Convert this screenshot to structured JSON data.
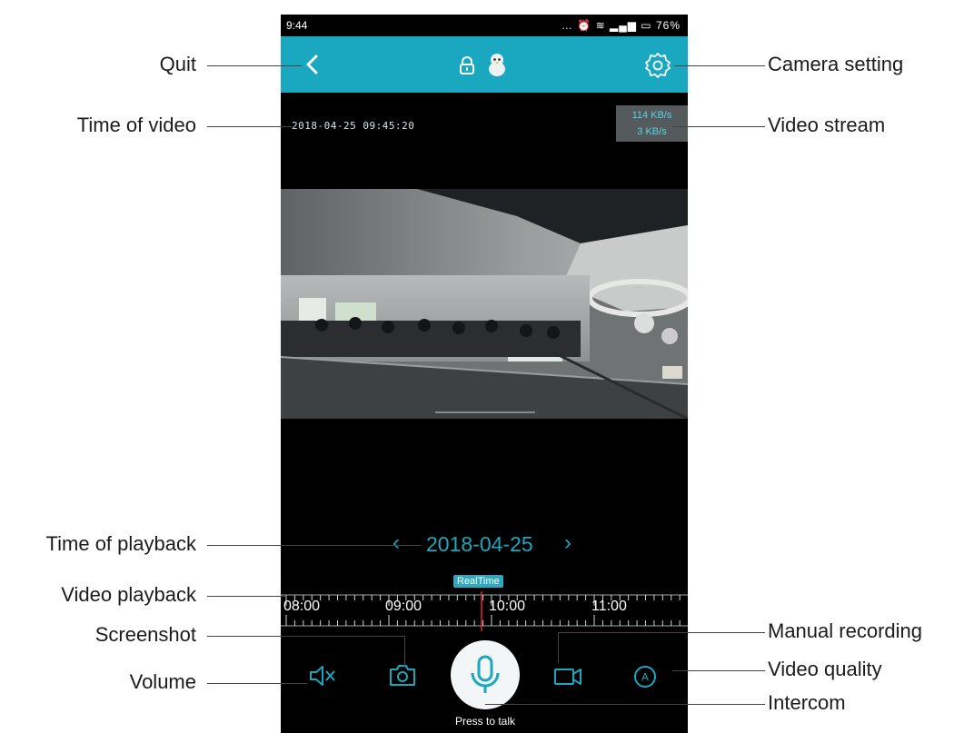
{
  "status_bar": {
    "time": "9:44",
    "battery": "76%"
  },
  "header": {
    "back_icon": "chevron-left-icon",
    "lock_icon": "lock-icon",
    "settings_icon": "gear-icon"
  },
  "video": {
    "osd_time": "2018-04-25 09:45:20",
    "stream_up": "114 KB/s",
    "stream_down": "3 KB/s"
  },
  "playback": {
    "date": "2018-04-25",
    "realtime_label": "RealTime",
    "times": [
      "08:00",
      "09:00",
      "10:00",
      "11:00"
    ]
  },
  "controls": {
    "talk_label": "Press to talk"
  },
  "annotations": {
    "quit": "Quit",
    "time_of_video": "Time of video",
    "time_of_playback": "Time of playback",
    "video_playback": "Video playback",
    "screenshot": "Screenshot",
    "volume": "Volume",
    "camera_setting": "Camera setting",
    "video_stream": "Video stream",
    "manual_recording": "Manual recording",
    "video_quality": "Video quality",
    "intercom": "Intercom"
  },
  "colors": {
    "accent": "#1aa7c0",
    "background": "#000000",
    "button": "#f3f6f6",
    "playhead": "#e8262b"
  }
}
